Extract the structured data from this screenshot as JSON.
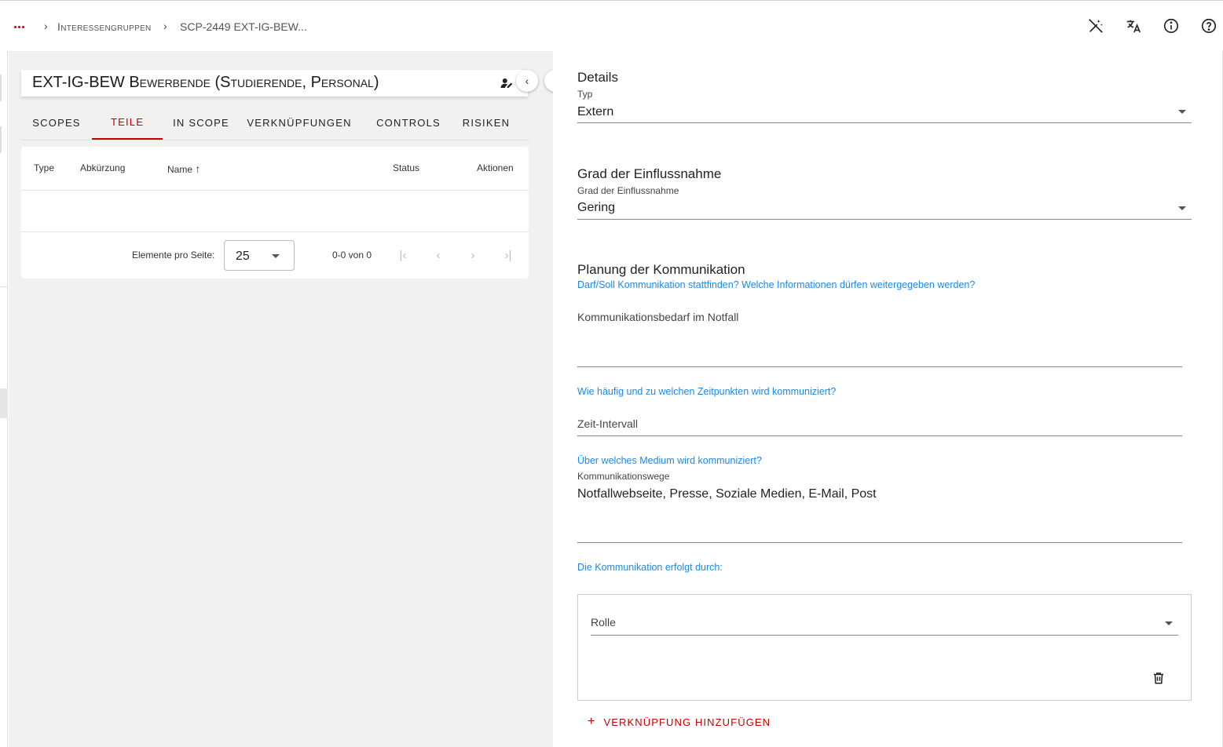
{
  "breadcrumb": {
    "items": [
      "Interessengruppen",
      "SCP-2449 EXT-IG-BEW..."
    ]
  },
  "toolbar": {
    "icons": [
      "wand-off-icon",
      "translate-icon",
      "info-icon",
      "help-icon"
    ]
  },
  "object": {
    "title": "EXT-IG-BEW Bewerbende (Studierende, Personal)"
  },
  "tabs": [
    {
      "label": "Scopes",
      "active": false
    },
    {
      "label": "Teile",
      "active": true
    },
    {
      "label": "In Scope",
      "active": false
    },
    {
      "label": "Verknüpfungen",
      "active": false
    },
    {
      "label": "Controls",
      "active": false
    },
    {
      "label": "Risiken",
      "active": false
    }
  ],
  "table": {
    "columns": [
      "Type",
      "Abkürzung",
      "Name",
      "Status",
      "Aktionen"
    ],
    "rows": [],
    "sort_indicator": "↑"
  },
  "pagination": {
    "items_per_page_label": "Elemente pro Seite:",
    "items_per_page": "25",
    "range": "0-0 von 0"
  },
  "details": {
    "section_title": "Details",
    "type_label": "Typ",
    "type_value": "Extern"
  },
  "influence": {
    "section_title": "Grad der Einflussnahme",
    "label": "Grad der Einflussnahme",
    "value": "Gering"
  },
  "communication": {
    "section_title": "Planung der Kommunikation",
    "hint1": "Darf/Soll Kommunikation stattfinden? Welche Informationen dürfen weitergegeben werden?",
    "emergency_placeholder": "Kommunikationsbedarf im Notfall",
    "hint2": "Wie häufig und zu welchen Zeitpunkten wird kommuniziert?",
    "interval_placeholder": "Zeit-Intervall",
    "hint3": "Über welches Medium wird kommuniziert?",
    "channels_label": "Kommunikationswege",
    "channels_value": "Notfallwebseite, Presse, Soziale Medien, E-Mail, Post",
    "hint4": "Die Kommunikation erfolgt durch:",
    "role_placeholder": "Rolle",
    "add_link_label": "Verknüpfung hinzufügen",
    "add_link_plus": "+"
  },
  "colors": {
    "accent": "#c00000",
    "hint": "#1e88e5",
    "panel_bg": "#f1f1f1"
  }
}
